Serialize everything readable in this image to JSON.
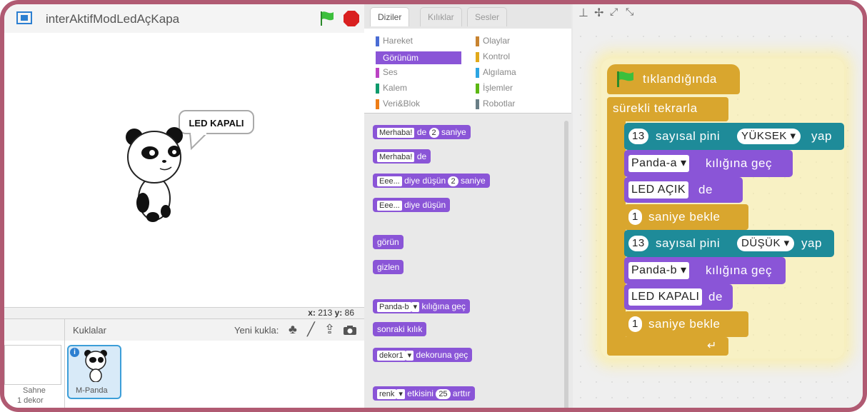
{
  "project": {
    "title": "interAktifModLedAçKapa"
  },
  "stage": {
    "bubble": "LED KAPALI",
    "coords": {
      "x_label": "x:",
      "x": "213",
      "y_label": "y:",
      "y": "86"
    }
  },
  "sprites": {
    "header": "Kuklalar",
    "new_sprite": "Yeni kukla:",
    "stage_label": "Sahne",
    "stage_sub": "1 dekor",
    "items": [
      {
        "name": "M-Panda"
      }
    ]
  },
  "tabs": [
    "Diziler",
    "Kılıklar",
    "Sesler"
  ],
  "categories": [
    {
      "label": "Hareket",
      "color": "#4a6cd4"
    },
    {
      "label": "Olaylar",
      "color": "#c88330"
    },
    {
      "label": "Görünüm",
      "color": "#8a55d7"
    },
    {
      "label": "Kontrol",
      "color": "#e1a91a"
    },
    {
      "label": "Ses",
      "color": "#bb42c3"
    },
    {
      "label": "Algılama",
      "color": "#2ca5e2"
    },
    {
      "label": "Kalem",
      "color": "#0e9a6c"
    },
    {
      "label": "İşlemler",
      "color": "#5cb712"
    },
    {
      "label": "Veri&Blok",
      "color": "#ee7d16"
    },
    {
      "label": "Robotlar",
      "color": "#697e86"
    }
  ],
  "palette": {
    "say_secs": {
      "input": "Merhaba!",
      "mid": "de",
      "num": "2",
      "end": "saniye"
    },
    "say": {
      "input": "Merhaba!",
      "end": "de"
    },
    "think_secs": {
      "input": "Eee...",
      "mid": "diye düşün",
      "num": "2",
      "end": "saniye"
    },
    "think": {
      "input": "Eee...",
      "end": "diye düşün"
    },
    "show": "görün",
    "hide": "gizlen",
    "switch_costume": {
      "drop": "Panda-b",
      "end": "kılığına geç"
    },
    "next_costume": "sonraki kılık",
    "switch_backdrop": {
      "drop": "dekor1",
      "end": "dekoruna geç"
    },
    "change_effect": {
      "drop": "renk",
      "mid": "etkisini",
      "num": "25",
      "end": "arttır"
    }
  },
  "script": {
    "hat": "tıklandığında",
    "forever": "sürekli tekrarla",
    "digital_high": {
      "pin": "13",
      "mid": "sayısal pini",
      "value": "YÜKSEK",
      "end": "yap"
    },
    "costume_a": {
      "drop": "Panda-a",
      "end": "kılığına geç"
    },
    "say_on": {
      "input": "LED AÇIK",
      "end": "de"
    },
    "wait_1": {
      "num": "1",
      "end": "saniye bekle"
    },
    "digital_low": {
      "pin": "13",
      "mid": "sayısal pini",
      "value": "DÜŞÜK",
      "end": "yap"
    },
    "costume_b": {
      "drop": "Panda-b",
      "end": "kılığına geç"
    },
    "say_off": {
      "input": "LED KAPALI",
      "end": "de"
    },
    "wait_2": {
      "num": "1",
      "end": "saniye bekle"
    }
  },
  "colors": {
    "looks": "#8a55d7",
    "control": "#d9a62e",
    "arduino": "#1e8b99",
    "flag": "#3cbf3c",
    "stop": "#d92020"
  }
}
